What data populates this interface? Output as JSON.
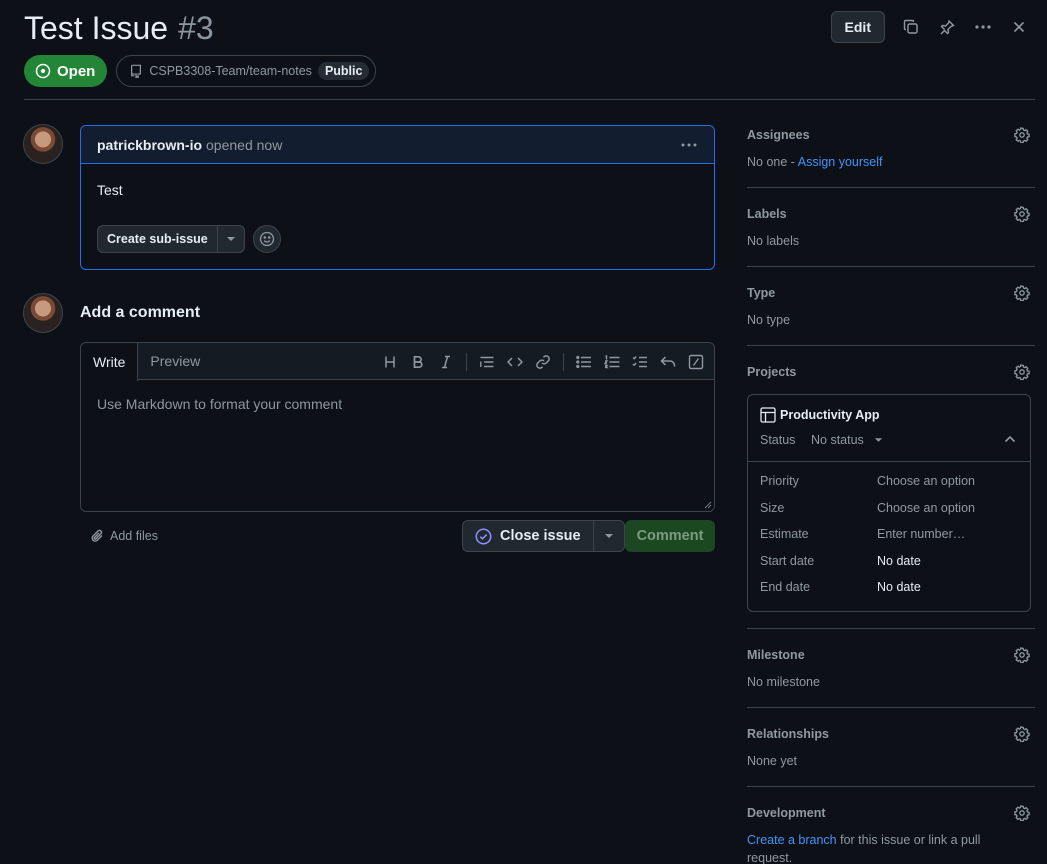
{
  "header": {
    "title": "Test Issue",
    "number": "#3",
    "edit_label": "Edit",
    "state_label": "Open",
    "repo": "CSPB3308-Team/team-notes",
    "visibility": "Public"
  },
  "issue": {
    "author": "patrickbrown-io",
    "meta": "opened now",
    "body": "Test",
    "subissue_label": "Create sub-issue"
  },
  "comment": {
    "title": "Add a comment",
    "tab_write": "Write",
    "tab_preview": "Preview",
    "placeholder": "Use Markdown to format your comment",
    "add_files": "Add files",
    "close_label": "Close issue",
    "comment_label": "Comment"
  },
  "sidebar": {
    "assignees": {
      "title": "Assignees",
      "value_prefix": "No one - ",
      "link": "Assign yourself"
    },
    "labels": {
      "title": "Labels",
      "value": "No labels"
    },
    "type": {
      "title": "Type",
      "value": "No type"
    },
    "projects": {
      "title": "Projects",
      "name": "Productivity App",
      "status_label": "Status",
      "status_value": "No status",
      "fields": [
        {
          "key": "Priority",
          "value": "Choose an option"
        },
        {
          "key": "Size",
          "value": "Choose an option"
        },
        {
          "key": "Estimate",
          "value": "Enter number…"
        },
        {
          "key": "Start date",
          "value": "No date"
        },
        {
          "key": "End date",
          "value": "No date"
        }
      ]
    },
    "milestone": {
      "title": "Milestone",
      "value": "No milestone"
    },
    "relationships": {
      "title": "Relationships",
      "value": "None yet"
    },
    "development": {
      "title": "Development",
      "link": "Create a branch",
      "value_suffix": " for this issue or link a pull request."
    }
  },
  "colors": {
    "accent": "#1f6feb",
    "open_green": "#238636",
    "link": "#4493f8"
  }
}
